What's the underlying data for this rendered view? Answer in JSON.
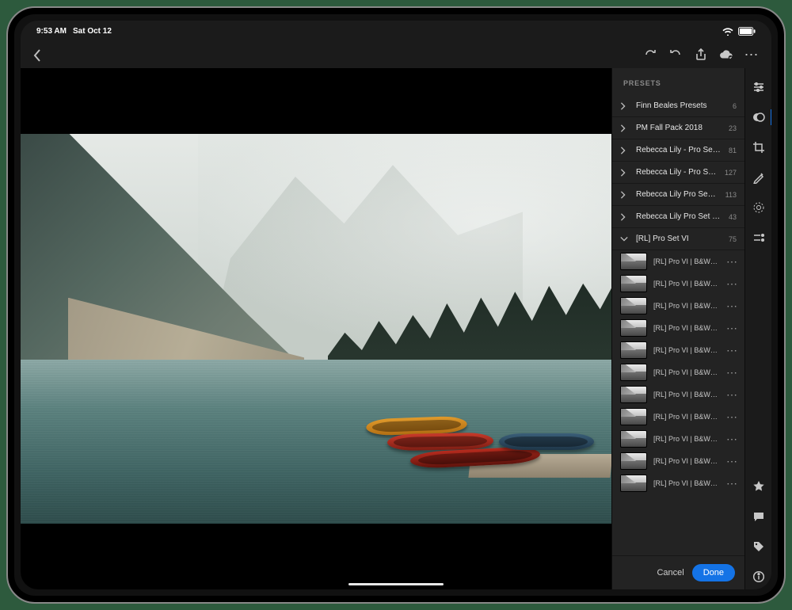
{
  "status": {
    "time": "9:53 AM",
    "date": "Sat Oct 12"
  },
  "toolbar": {},
  "panel": {
    "title": "PRESETS",
    "groups": [
      {
        "label": "Finn Beales Presets",
        "count": "6",
        "open": false
      },
      {
        "label": "PM Fall Pack 2018",
        "count": "23",
        "open": false
      },
      {
        "label": "Rebecca Lily - Pro Set III",
        "count": "81",
        "open": false
      },
      {
        "label": "Rebecca Lily - Pro Set IV",
        "count": "127",
        "open": false
      },
      {
        "label": "Rebecca Lily Pro Set V",
        "count": "113",
        "open": false
      },
      {
        "label": "Rebecca Lily Pro Set V Tools",
        "count": "43",
        "open": false
      },
      {
        "label": "[RL] Pro Set VI",
        "count": "75",
        "open": true
      }
    ],
    "presets": [
      {
        "label": "[RL] Pro VI | B&W | Arctic I"
      },
      {
        "label": "[RL] Pro VI | B&W | Arctic II"
      },
      {
        "label": "[RL] Pro VI | B&W | Arctic III"
      },
      {
        "label": "[RL] Pro VI | B&W | Casabl…"
      },
      {
        "label": "[RL] Pro VI | B&W | Casabl…"
      },
      {
        "label": "[RL] Pro VI | B&W | Casabl…"
      },
      {
        "label": "[RL] Pro VI | B&W | Fog I"
      },
      {
        "label": "[RL] Pro VI | B&W | Fog II"
      },
      {
        "label": "[RL] Pro VI | B&W | Fog III"
      },
      {
        "label": "[RL] Pro VI | B&W | Glacier I"
      },
      {
        "label": "[RL] Pro VI | B&W | Glacier II"
      }
    ],
    "cancel": "Cancel",
    "done": "Done"
  }
}
